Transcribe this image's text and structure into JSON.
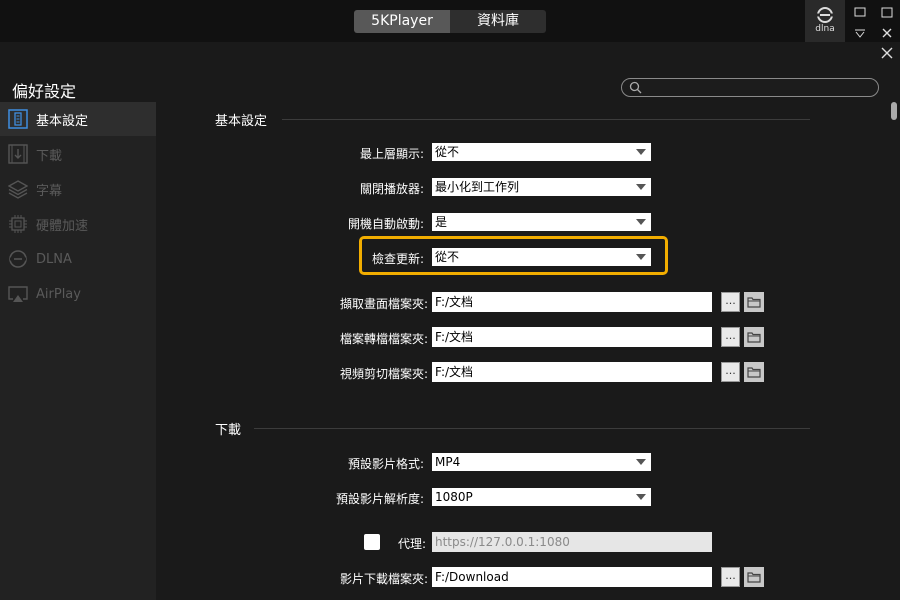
{
  "titlebar": {
    "tabs": [
      {
        "label": "5KPlayer",
        "active": true
      },
      {
        "label": "資料庫",
        "active": false
      }
    ],
    "dlna_label": "dlna"
  },
  "header": {
    "title": "偏好設定",
    "search_placeholder": ""
  },
  "sidebar": {
    "items": [
      {
        "label": "基本設定",
        "icon": "settings-icon",
        "active": true
      },
      {
        "label": "下載",
        "icon": "download-icon",
        "active": false
      },
      {
        "label": "字幕",
        "icon": "subtitle-layers-icon",
        "active": false
      },
      {
        "label": "硬體加速",
        "icon": "chip-icon",
        "active": false
      },
      {
        "label": "DLNA",
        "icon": "dlna-icon",
        "active": false
      },
      {
        "label": "AirPlay",
        "icon": "airplay-icon",
        "active": false
      }
    ]
  },
  "basic": {
    "section_title": "基本設定",
    "always_on_top": {
      "label": "最上層顯示:",
      "value": "從不"
    },
    "close_player": {
      "label": "關閉播放器:",
      "value": "最小化到工作列"
    },
    "autostart": {
      "label": "開機自動啟動:",
      "value": "是"
    },
    "check_update": {
      "label": "檢查更新:",
      "value": "從不"
    },
    "snapshot_folder": {
      "label": "擷取畫面檔案夾:",
      "value": "F:/文档"
    },
    "convert_folder": {
      "label": "檔案轉檔檔案夾:",
      "value": "F:/文档"
    },
    "cut_folder": {
      "label": "視頻剪切檔案夾:",
      "value": "F:/文档"
    },
    "browse_label": "..."
  },
  "download": {
    "section_title": "下載",
    "format": {
      "label": "預設影片格式:",
      "value": "MP4"
    },
    "resolution": {
      "label": "預設影片解析度:",
      "value": "1080P"
    },
    "proxy": {
      "label": "代理:",
      "value": "https://127.0.0.1:1080",
      "enabled": false
    },
    "download_folder": {
      "label": "影片下載檔案夾:",
      "value": "F:/Download"
    }
  },
  "colors": {
    "highlight": "#f2ad00",
    "active_tab": "#585858",
    "background": "#1a1a1a"
  }
}
